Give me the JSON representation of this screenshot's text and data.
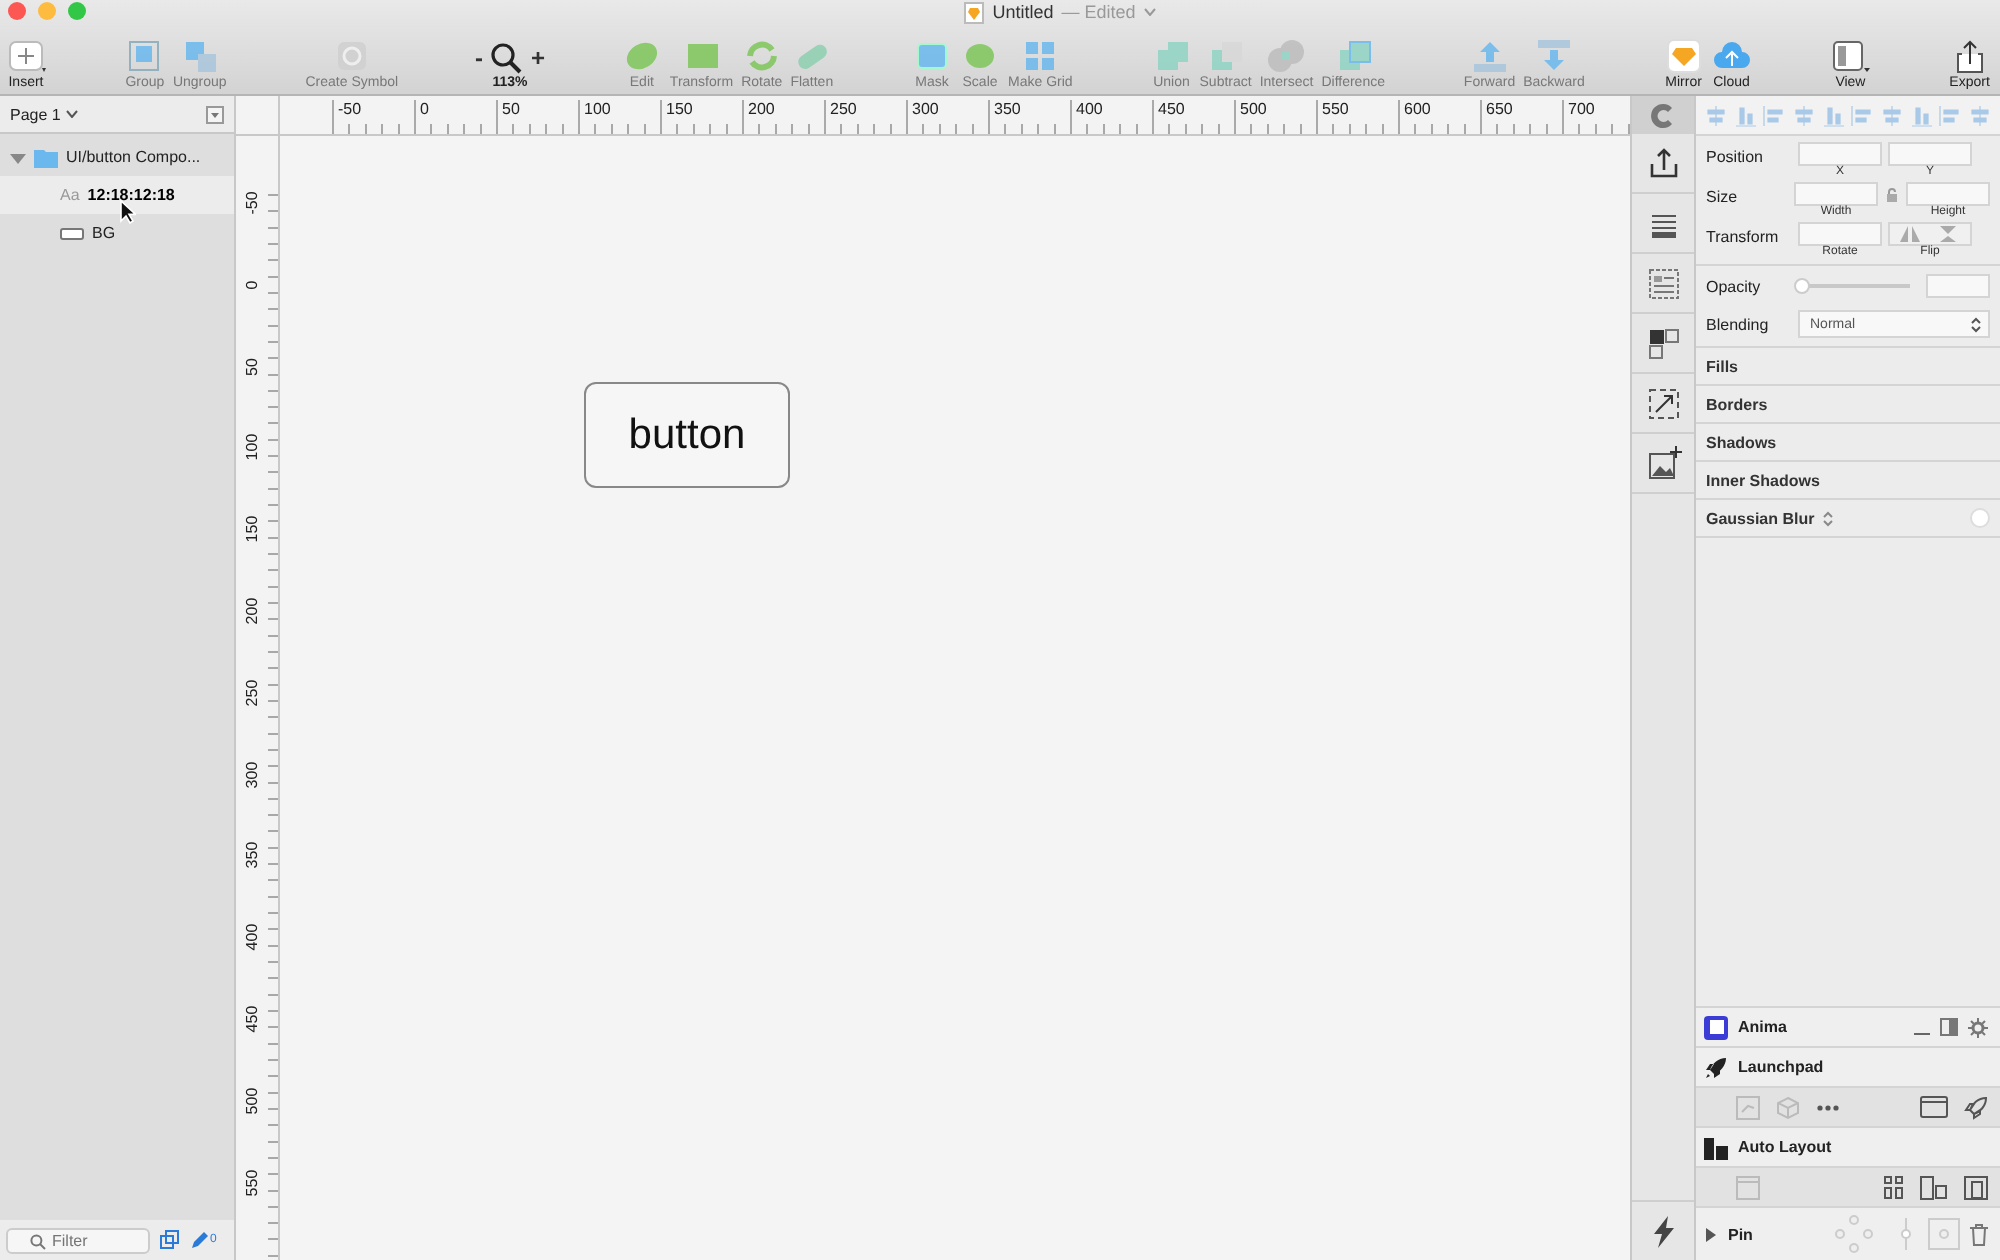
{
  "window": {
    "title": "Untitled",
    "status": "— Edited"
  },
  "toolbar": {
    "groups": [
      [
        {
          "kind": "tool",
          "label": "Insert",
          "disabled": false
        }
      ],
      [
        {
          "kind": "tool",
          "label": "Group",
          "disabled": true
        },
        {
          "kind": "tool",
          "label": "Ungroup",
          "disabled": true
        }
      ],
      [
        {
          "kind": "tool",
          "label": "Create Symbol",
          "disabled": true
        }
      ],
      [
        {
          "kind": "zoom",
          "minus": "-",
          "plus": "+",
          "label": "113%",
          "disabled": false
        }
      ],
      [
        {
          "kind": "tool",
          "label": "Edit",
          "disabled": true
        },
        {
          "kind": "tool",
          "label": "Transform",
          "disabled": true
        },
        {
          "kind": "tool",
          "label": "Rotate",
          "disabled": true
        },
        {
          "kind": "tool",
          "label": "Flatten",
          "disabled": true
        }
      ],
      [
        {
          "kind": "tool",
          "label": "Mask",
          "disabled": true
        },
        {
          "kind": "tool",
          "label": "Scale",
          "disabled": true
        },
        {
          "kind": "tool",
          "label": "Make Grid",
          "disabled": true
        }
      ],
      [
        {
          "kind": "tool",
          "label": "Union",
          "disabled": true
        },
        {
          "kind": "tool",
          "label": "Subtract",
          "disabled": true
        },
        {
          "kind": "tool",
          "label": "Intersect",
          "disabled": true
        },
        {
          "kind": "tool",
          "label": "Difference",
          "disabled": true
        }
      ],
      [
        {
          "kind": "tool",
          "label": "Forward",
          "disabled": true
        },
        {
          "kind": "tool",
          "label": "Backward",
          "disabled": true
        }
      ],
      [
        {
          "kind": "tool",
          "label": "Mirror",
          "disabled": false
        },
        {
          "kind": "tool",
          "label": "Cloud",
          "disabled": false
        }
      ],
      [
        {
          "kind": "tool",
          "label": "View",
          "disabled": false
        }
      ],
      [
        {
          "kind": "tool",
          "label": "Export",
          "disabled": false
        }
      ]
    ]
  },
  "layers": {
    "page": "Page 1",
    "items": [
      {
        "kind": "group",
        "name": "UI/button Compo...",
        "expanded": true,
        "selected": false,
        "children": [
          {
            "kind": "text",
            "glyph": "Aa",
            "name": "12:18:12:18",
            "selected": true
          },
          {
            "kind": "shape",
            "name": "BG",
            "selected": false
          }
        ]
      }
    ],
    "filter_placeholder": "Filter",
    "count": "0"
  },
  "rulers": {
    "horizontal": [
      "-50",
      "0",
      "50",
      "100",
      "150",
      "200",
      "250",
      "300",
      "350",
      "400",
      "450",
      "500",
      "550",
      "600",
      "650",
      "700"
    ],
    "vertical": [
      "-50",
      "0",
      "50",
      "100",
      "150",
      "200",
      "250",
      "300",
      "350",
      "400",
      "450",
      "500",
      "550"
    ]
  },
  "canvas": {
    "elements": [
      {
        "kind": "button",
        "label": "button"
      }
    ]
  },
  "inspector": {
    "rows": [
      {
        "kind": "pair",
        "label": "Position",
        "fields": [
          {
            "caption": "X"
          },
          {
            "caption": "Y"
          }
        ]
      },
      {
        "kind": "size",
        "label": "Size",
        "fields": [
          {
            "caption": "Width"
          },
          {
            "caption": "Height"
          }
        ]
      },
      {
        "kind": "transform",
        "label": "Transform",
        "fields": [
          {
            "caption": "Rotate"
          },
          {
            "caption": "Flip"
          }
        ]
      }
    ],
    "opacity": {
      "label": "Opacity",
      "level": 0
    },
    "blending": {
      "label": "Blending",
      "value": "Normal"
    },
    "sections": [
      {
        "kind": "plain",
        "title": "Fills"
      },
      {
        "kind": "plain",
        "title": "Borders"
      },
      {
        "kind": "plain",
        "title": "Shadows"
      },
      {
        "kind": "plain",
        "title": "Inner Shadows"
      },
      {
        "kind": "blur",
        "title": "Gaussian Blur"
      }
    ]
  },
  "plugin": {
    "anima": "Anima",
    "launchpad": "Launchpad",
    "auto_layout": "Auto Layout",
    "pin": "Pin",
    "pin_expanded": false
  }
}
